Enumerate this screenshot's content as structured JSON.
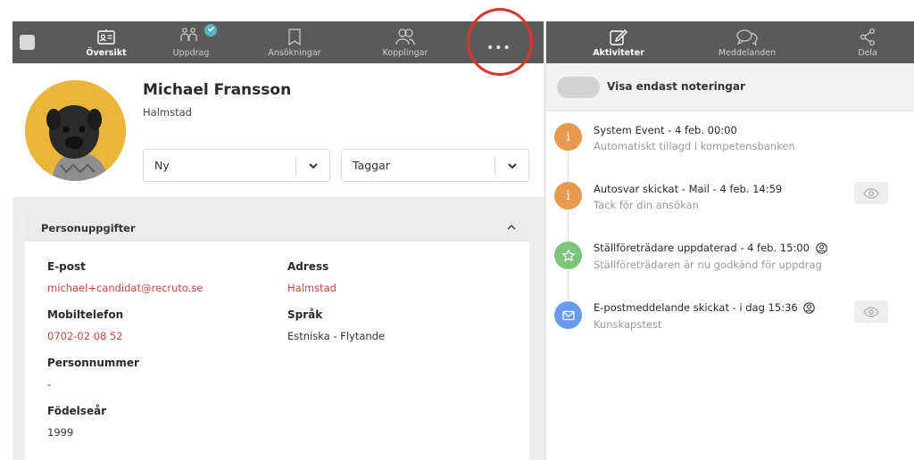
{
  "nav": {
    "tabs": [
      {
        "label": "Översikt",
        "icon": "id-card-icon",
        "active": true
      },
      {
        "label": "Uppdrag",
        "icon": "people-icon",
        "active": false
      },
      {
        "label": "Ansökningar",
        "icon": "bookmark-icon",
        "active": false
      },
      {
        "label": "Kopplingar",
        "icon": "users-icon",
        "active": false
      }
    ],
    "more_label": "•••",
    "right_tabs": [
      {
        "label": "Aktiviteter",
        "icon": "edit-icon",
        "active": true
      },
      {
        "label": "Meddelanden",
        "icon": "chat-icon",
        "active": false
      },
      {
        "label": "Dela",
        "icon": "share-icon",
        "active": false
      }
    ]
  },
  "profile": {
    "name": "Michael Fransson",
    "city": "Halmstad",
    "status_select": "Ny",
    "tags_select": "Taggar"
  },
  "personal": {
    "header": "Personuppgifter",
    "email_label": "E-post",
    "email": "michael+candidat@recruto.se",
    "address_label": "Adress",
    "address": "Halmstad",
    "phone_label": "Mobiltelefon",
    "phone": "0702-02 08 52",
    "language_label": "Språk",
    "language": "Estniska - Flytande",
    "ssn_label": "Personnummer",
    "ssn": "-",
    "birthyear_label": "Födelseår",
    "birthyear": "1999"
  },
  "activities": {
    "toggle_label": "Visa endast noteringar",
    "events": [
      {
        "title": "System Event - 4 feb. 00:00",
        "sub": "Automatiskt tillagd i kompetensbanken",
        "icon": "info-icon",
        "color": "#e59a4e"
      },
      {
        "title": "Autosvar skickat - Mail - 4 feb. 14:59",
        "sub": "Tack för din ansökan",
        "icon": "info-icon",
        "color": "#e59a4e"
      },
      {
        "title": "Ställföreträdare uppdaterad - 4 feb. 15:00",
        "sub": "Ställföreträdaren är nu godkänd för uppdrag",
        "icon": "star-icon",
        "color": "#7cc57a"
      },
      {
        "title": "E-postmeddelande skickat - i dag 15:36",
        "sub": "Kunskapstest",
        "icon": "mail-icon",
        "color": "#6a9bea"
      }
    ]
  },
  "colors": {
    "accent_red": "#c8473d",
    "topbar": "#5a5a5a",
    "highlight_ring": "#e0312b"
  }
}
